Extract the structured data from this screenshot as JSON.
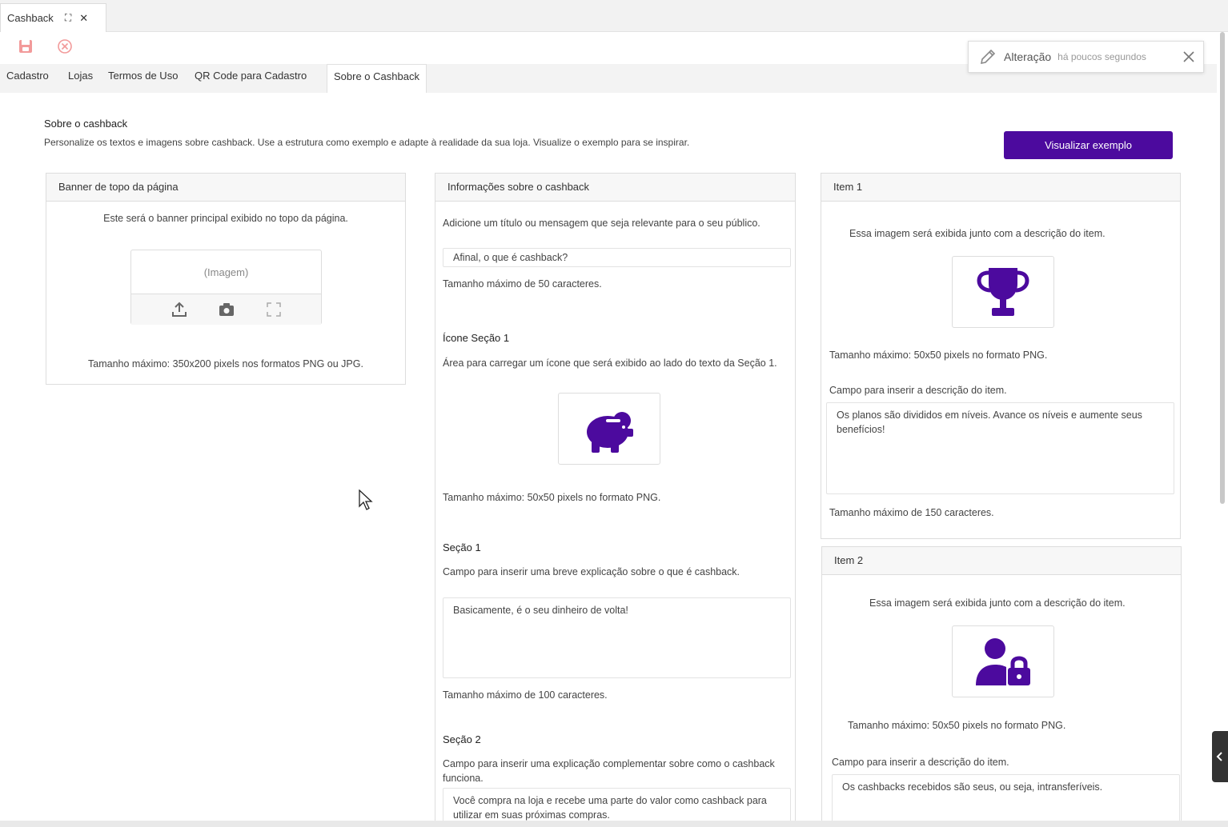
{
  "window": {
    "tab_title": "Cashback"
  },
  "nav": {
    "tabs": [
      {
        "label": "Cadastro"
      },
      {
        "label": "Lojas"
      },
      {
        "label": "Termos de Uso"
      },
      {
        "label": "QR Code para Cadastro"
      },
      {
        "label": "Sobre o Cashback"
      }
    ],
    "active_tab": "Sobre o Cashback"
  },
  "notification": {
    "label": "Alteração",
    "time": "há poucos segundos"
  },
  "page": {
    "title": "Sobre o cashback",
    "description": "Personalize os textos e imagens sobre cashback. Use a estrutura como exemplo e adapte à realidade da sua loja. Visualize o exemplo para se inspirar.",
    "preview_button": "Visualizar exemplo"
  },
  "banner": {
    "header": "Banner de topo da página",
    "info": "Este será o banner principal exibido no topo da página.",
    "placeholder": "(Imagem)",
    "size_note": "Tamanho máximo: 350x200 pixels nos formatos PNG ou JPG."
  },
  "info": {
    "header": "Informações sobre o cashback",
    "title_help": "Adicione um título ou mensagem que seja relevante para o seu público.",
    "title_value": "Afinal, o que é cashback?",
    "title_limit": "Tamanho máximo de 50 caracteres.",
    "icon_label": "Ícone Seção 1",
    "icon_help": "Área para carregar um ícone que será exibido ao lado do texto da Seção 1.",
    "icon_name": "piggy-bank-icon",
    "icon_size": "Tamanho máximo: 50x50 pixels no formato PNG.",
    "section1_label": "Seção 1",
    "section1_help": "Campo para inserir uma breve explicação sobre o que é cashback.",
    "section1_value": "Basicamente, é o seu dinheiro de volta!",
    "section1_limit": "Tamanho máximo de 100 caracteres.",
    "section2_label": "Seção 2",
    "section2_help": "Campo para inserir uma explicação complementar sobre como o cashback funciona.",
    "section2_value": "Você compra na loja e recebe uma parte do valor como cashback para utilizar em suas próximas compras."
  },
  "item1": {
    "header": "Item 1",
    "info": "Essa  imagem será exibida junto com a descrição do item.",
    "icon_name": "trophy-icon",
    "size_note": "Tamanho máximo: 50x50 pixels no formato PNG.",
    "desc_help": "Campo para inserir a descrição do item.",
    "desc_value": "Os planos são divididos em níveis. Avance os níveis e aumente seus benefícios!",
    "desc_limit": "Tamanho máximo de 150 caracteres."
  },
  "item2": {
    "header": "Item 2",
    "info": "Essa imagem será exibida junto com a descrição do item.",
    "icon_name": "user-lock-icon",
    "size_note": "Tamanho máximo: 50x50 pixels no formato PNG.",
    "desc_help": "Campo para inserir a descrição do item.",
    "desc_value": "Os cashbacks recebidos são seus, ou seja, intransferíveis."
  },
  "colors": {
    "accent": "#4c0a9e",
    "toolbar_icon": "#f29a9a"
  }
}
